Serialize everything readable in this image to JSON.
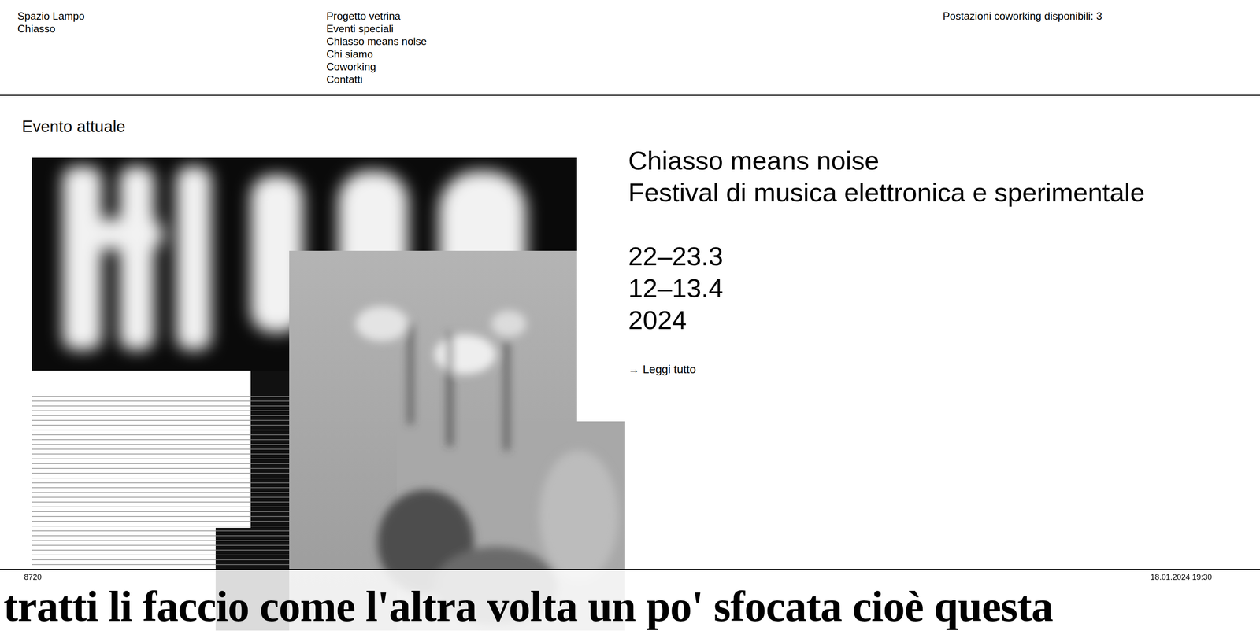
{
  "brand": [
    "Spazio Lampo",
    "Chiasso"
  ],
  "nav": [
    "Progetto vetrina",
    "Eventi speciali",
    "Chiasso means noise",
    "Chi siamo",
    "Coworking",
    "Contatti"
  ],
  "coworking": "Postazioni coworking disponibili: 3",
  "section_title": "Evento attuale",
  "event": {
    "title": "Chiasso means noise",
    "subtitle": "Festival di musica elettronica e sperimentale",
    "dates": [
      "22–23.3",
      "12–13.4",
      "2024"
    ],
    "link": "→ Leggi tutto"
  },
  "ticker": {
    "left": "8720",
    "right": "18.01.2024 19:30",
    "text": "tratti li faccio come l'altra volta un po' sfocata cioè questa"
  }
}
